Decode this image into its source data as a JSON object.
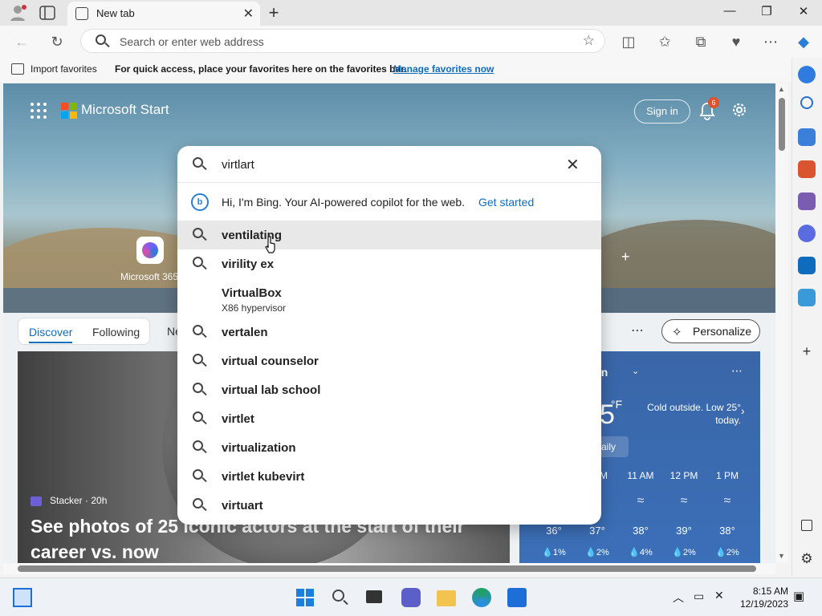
{
  "browser": {
    "tab_title": "New tab",
    "address_placeholder": "Search or enter web address"
  },
  "favorites_bar": {
    "import_label": "Import favorites",
    "hint": "For quick access, place your favorites here on the favorites bar.",
    "manage_link": "Manage favorites now"
  },
  "start_page": {
    "brand": "Microsoft Start",
    "sign_in": "Sign in",
    "notification_count": "6",
    "tile_label": "Microsoft 365",
    "tabs": [
      "Discover",
      "Following",
      "Ne"
    ],
    "personalize": "Personalize"
  },
  "news_card": {
    "source": "Stacker · 20h",
    "headline": "See photos of 25 iconic actors at the start of their career vs. now"
  },
  "weather": {
    "location": "gton",
    "temp": "5",
    "unit": "°F",
    "note": "Cold outside. Low 25° today.",
    "daily": "aily",
    "hours": [
      {
        "time": "M",
        "temp": "36°",
        "precip": "1%"
      },
      {
        "time": "11 AM",
        "temp": "37°",
        "precip": "2%"
      },
      {
        "time": "12 PM",
        "temp": "38°",
        "precip": "4%"
      },
      {
        "time": "1 PM",
        "temp": "39°",
        "precip": "2%"
      },
      {
        "time": "",
        "temp": "38°",
        "precip": "2%"
      }
    ]
  },
  "search_dropdown": {
    "query": "virtlart",
    "bing_text": "Hi, I'm Bing. Your AI-powered copilot for the web.",
    "bing_link": "Get started",
    "suggestions": [
      {
        "label": "ventilating"
      },
      {
        "label": "virility ex"
      },
      {
        "label": "VirtualBox",
        "sub": "X86 hypervisor"
      },
      {
        "label": "vertalen"
      },
      {
        "label": "virtual counselor"
      },
      {
        "label": "virtual lab school"
      },
      {
        "label": "virtlet"
      },
      {
        "label": "virtualization"
      },
      {
        "label": "virtlet kubevirt"
      },
      {
        "label": "virtuart"
      }
    ]
  },
  "taskbar": {
    "time": "8:15 AM",
    "date": "12/19/2023"
  },
  "colors": {
    "accent": "#0f6cbd",
    "notification_badge": "#e0522b"
  }
}
